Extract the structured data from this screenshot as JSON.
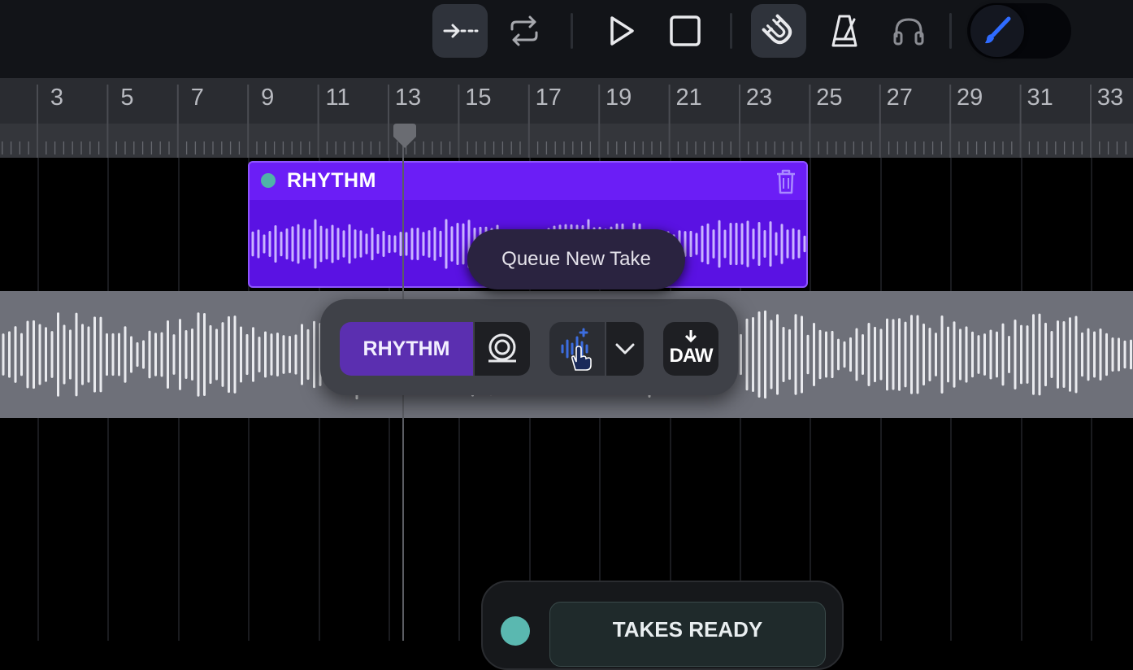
{
  "toolbar": {
    "buttons": [
      {
        "name": "skip-to-start-icon",
        "active": true
      },
      {
        "name": "loop-icon",
        "active": false
      },
      {
        "name": "play-icon",
        "active": false
      },
      {
        "name": "stop-icon",
        "active": false
      },
      {
        "name": "snap-magnet-icon",
        "active": true
      },
      {
        "name": "metronome-icon",
        "active": false
      },
      {
        "name": "headphones-icon",
        "active": false
      },
      {
        "name": "brush-icon",
        "active": true
      }
    ],
    "brush_color": "#2f6bff"
  },
  "ruler": {
    "labels": [
      "3",
      "5",
      "7",
      "9",
      "11",
      "13",
      "15",
      "17",
      "19",
      "21",
      "23",
      "25",
      "27",
      "29",
      "31",
      "33"
    ]
  },
  "clip": {
    "label": "RHYTHM",
    "color": "#5a12e3",
    "dot_color": "#4fb3a8"
  },
  "tooltip": {
    "text": "Queue New Take"
  },
  "panel": {
    "track_label": "RHYTHM",
    "daw_label": "DAW"
  },
  "takes": {
    "label": "TAKES READY",
    "dot_color": "#5ab8b0"
  }
}
